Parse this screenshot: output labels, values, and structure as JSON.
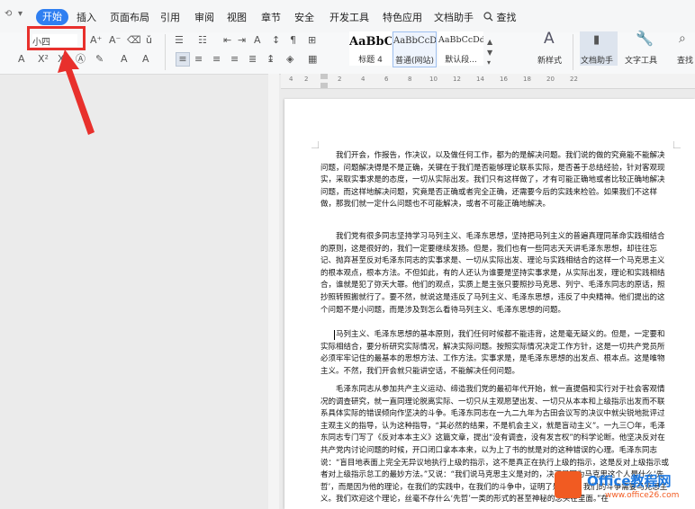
{
  "menubar": {
    "quick_icons": [
      "⟲",
      "▾"
    ],
    "tabs": [
      "开始",
      "插入",
      "页面布局",
      "引用",
      "审阅",
      "视图",
      "章节",
      "安全",
      "开发工具",
      "特色应用",
      "文档助手"
    ],
    "search": "查找"
  },
  "toolbar": {
    "font_size_value": "小四",
    "styles": [
      {
        "sample": "AaBbC",
        "label": "标题 4"
      },
      {
        "sample": "AaBbCcD",
        "label": "普通(网站)"
      },
      {
        "sample": "AaBbCcDd",
        "label": "默认段..."
      }
    ],
    "new_style": "新样式",
    "doc_helper": "文档助手",
    "text_tools": "文字工具",
    "find": "查找"
  },
  "ruler": {
    "numbers": [
      "4",
      "2",
      "2",
      "4",
      "6",
      "8",
      "10",
      "12",
      "14",
      "16",
      "18",
      "20",
      "22"
    ]
  },
  "document": {
    "paragraphs": [
      "　　我们开会，作报告，作决议，以及做任何工作，都为的是解决问题。我们说的做的究竟能不能解决问题，问题解决得是不是正确，关键在于我们是否能够理论联系实际，是否善于总结经验，针对客观现实，采取实事求是的态度，一切从实际出发。我们只有这样做了，才有可能正确地或者比较正确地解决问题，而这样地解决问题，究竟是否正确或者完全正确，还需要今后的实践来检验。如果我们不这样做，那我们就一定什么问题也不可能解决，或者不可能正确地解决。",
      "　　我们党有很多同志坚持学习马列主义、毛泽东思想，坚持把马列主义的普遍真理同革命实践相结合的原则，这是很好的，我们一定要继续发扬。但是，我们也有一些同志天天讲毛泽东思想，却往往忘记、抛弃甚至反对毛泽东同志的实事求是、一切从实际出发、理论与实践相结合的这样一个马克思主义的根本观点，根本方法。不但如此，有的人还认为谁要是坚持实事求是，从实际出发，理论和实践相结合，谁就是犯了弥天大罪。他们的观点，实质上是主张只要照抄马克思、列宁、毛泽东同志的原话，照抄照转照搬就行了。要不然，就说这是违反了马列主义、毛泽东思想，违反了中央精神。他们提出的这个问题不是小问题，而是涉及到怎么看待马列主义、毛泽东思想的问题。",
      "　　马列主义、毛泽东思想的基本原则，我们任何时候都不能违背，这是毫无疑义的。但是，一定要和实际相结合，要分析研究实际情况，解决实际问题。按照实际情况决定工作方针，这是一切共产党员所必须牢牢记住的最基本的思想方法、工作方法。实事求是，是毛泽东思想的出发点、根本点。这是唯物主义。不然，我们开会就只能讲空话，不能解决任何问题。",
      "　　毛泽东同志从参加共产主义运动、缔造我们党的最初年代开始，就一直提倡和实行对于社会客观情况的调查研究，就一直同理论脱离实际、一切只从主观愿望出发、一切只从本本和上级指示出发而不联系具体实际的错误倾向作坚决的斗争。毛泽东同志在一九二九年为古田会议写的决议中就尖锐地批评过主观主义的指导，认为这种指导，“其必然的结果，不是机会主义，就是盲动主义”。一九三〇年，毛泽东同志专门写了《反对本本主义》这篇文章，提出“没有调查，没有发言权”的科学论断。他坚决反对在共产党内讨论问题的时候，开口闭口拿本本来，以为上了书的就是对的这种错误的心理。毛泽东同志说：“盲目地表面上完全无异议地执行上级的指示，这不是真正在执行上级的指示，这是反对上级指示或者对上级指示怠工的最妙方法。”又说：“我们说马克思主义是对的，决不是因为马克思这个人是什么‘先哲’，而是因为他的理论，在我们的实践中，在我们的斗争中，证明了是对的。我们的斗争需要马克思主义。我们欢迎这个理论，丝毫不存什么‘先哲’一类的形式的甚至神秘的念头在里面。”在"
    ]
  },
  "watermark": {
    "name": "Office教程网",
    "url": "www.office26.com"
  },
  "colors": {
    "accent": "#2f7ff1",
    "highlight": "#e8302c",
    "brand_orange": "#f15b22"
  }
}
